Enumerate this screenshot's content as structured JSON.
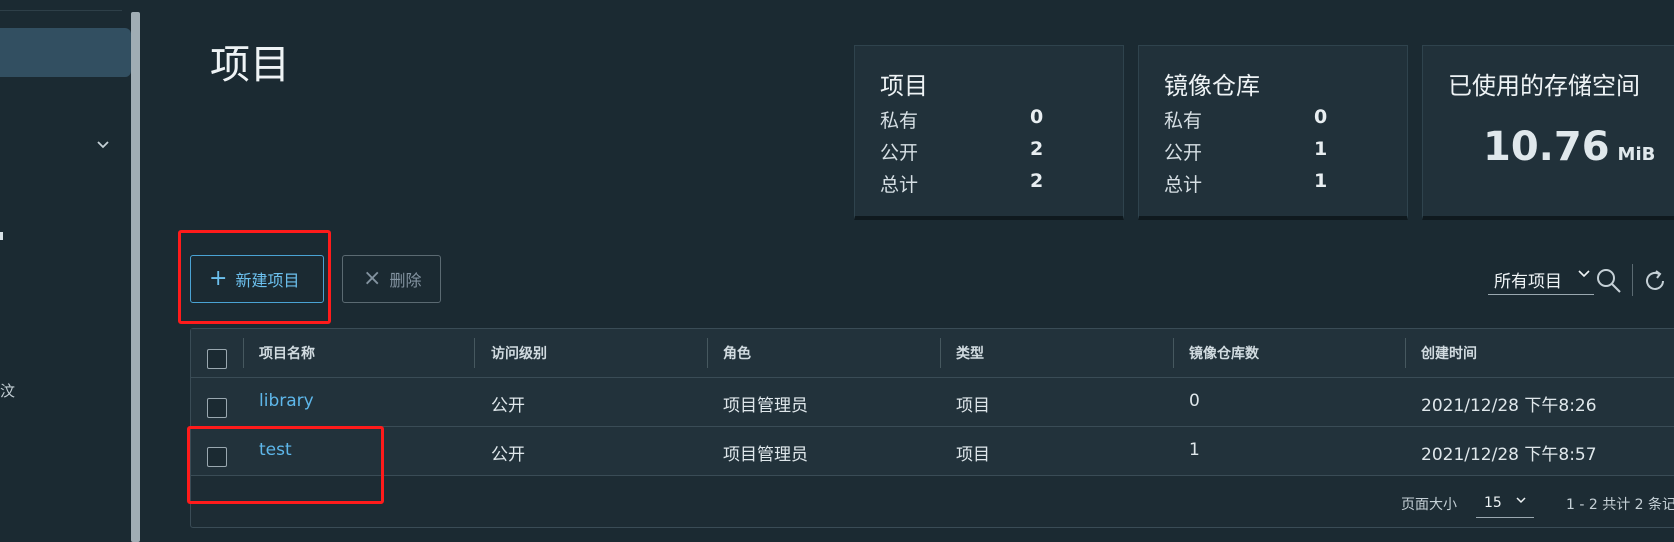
{
  "sidebar": {
    "chevron_icon": "chevron-down-icon",
    "fragment_text": "汶"
  },
  "page": {
    "title": "项目"
  },
  "cards": {
    "projects": {
      "title": "项目",
      "rows": [
        {
          "label": "私有",
          "value": "0"
        },
        {
          "label": "公开",
          "value": "2"
        },
        {
          "label": "总计",
          "value": "2"
        }
      ]
    },
    "repos": {
      "title": "镜像仓库",
      "rows": [
        {
          "label": "私有",
          "value": "0"
        },
        {
          "label": "公开",
          "value": "1"
        },
        {
          "label": "总计",
          "value": "1"
        }
      ]
    },
    "storage": {
      "title": "已使用的存储空间",
      "value": "10.76",
      "unit": "MiB"
    }
  },
  "toolbar": {
    "new_label": "新建项目",
    "delete_label": "删除",
    "filter_label": "所有项目"
  },
  "table": {
    "headers": [
      "项目名称",
      "访问级别",
      "角色",
      "类型",
      "镜像仓库数",
      "创建时间"
    ],
    "rows": [
      {
        "name": "library",
        "access": "公开",
        "role": "项目管理员",
        "type": "项目",
        "repo_count": "0",
        "created": "2021/12/28 下午8:26"
      },
      {
        "name": "test",
        "access": "公开",
        "role": "项目管理员",
        "type": "项目",
        "repo_count": "1",
        "created": "2021/12/28 下午8:57"
      }
    ],
    "footer": {
      "page_size_label": "页面大小",
      "page_size": "15",
      "summary": "1 - 2 共计 2 条记"
    }
  },
  "highlight_color": "#ff1b1b",
  "accent_color": "#4aa3d4"
}
